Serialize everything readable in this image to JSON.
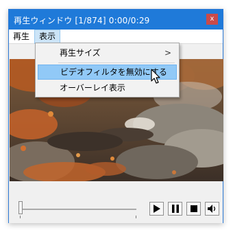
{
  "window": {
    "title": "再生ウィンドウ  [1/874]  0:00/0:29",
    "close_glyph": "x"
  },
  "menubar": {
    "items": [
      {
        "label": "再生"
      },
      {
        "label": "表示"
      }
    ]
  },
  "dropdown": {
    "items": [
      {
        "label": "再生サイズ",
        "submenu_arrow": ">"
      },
      {
        "label": "ビデオフィルタを無効にする",
        "highlighted": true
      },
      {
        "label": "オーバーレイ表示"
      }
    ]
  },
  "controls": {
    "seek_position": 0,
    "buttons": [
      "play-icon",
      "pause-icon",
      "stop-icon",
      "speaker-icon"
    ]
  },
  "colors": {
    "titlebar": "#1f7ad9",
    "close": "#c94a4a",
    "menu_highlight": "#91c9f7"
  }
}
